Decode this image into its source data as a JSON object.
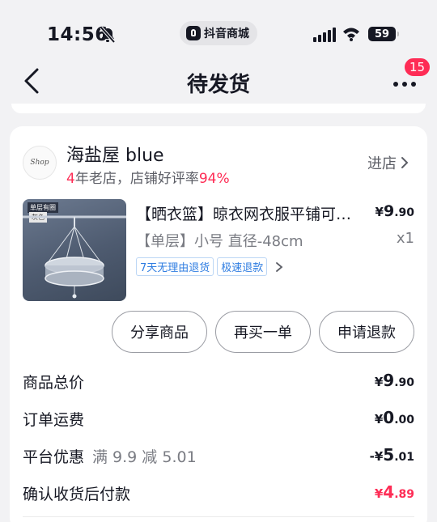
{
  "status_bar": {
    "time": "14:56",
    "app_name": "抖音商城",
    "battery": "59"
  },
  "nav": {
    "title": "待发货",
    "badge": "15"
  },
  "shop": {
    "avatar_text": "Shop",
    "name": "海盐屋 blue",
    "years": "4",
    "years_suffix": "年老店，店铺好评率",
    "rating": "94%",
    "enter_label": "进店"
  },
  "product": {
    "thumb_tag": "单层有圈",
    "thumb_tag2": "灰色",
    "title": "【晒衣篮】晾衣网衣服平铺可晾晒毛衣",
    "price_yen": "¥",
    "price_int": "9",
    "price_dec": ".90",
    "spec": "【单层】小号 直径-48cm",
    "qty": "x1",
    "tags": [
      "7天无理由退货",
      "极速退款"
    ]
  },
  "actions": {
    "share": "分享商品",
    "rebuy": "再买一单",
    "refund": "申请退款"
  },
  "summary": {
    "total_label": "商品总价",
    "total_yen": "¥",
    "total_int": "9",
    "total_dec": ".90",
    "shipping_label": "订单运费",
    "shipping_yen": "¥",
    "shipping_int": "0",
    "shipping_dec": ".00",
    "discount_label": "平台优惠",
    "discount_sub": "满 9.9 减 5.01",
    "discount_yen": "-¥",
    "discount_int": "5",
    "discount_dec": ".01",
    "pay_label": "确认收货后付款",
    "pay_yen": "¥",
    "pay_int": "4",
    "pay_dec": ".89"
  },
  "colors": {
    "accent": "#fe2c55",
    "tag_blue": "#2f7de1"
  },
  "icons": {
    "back": "chevron-left-icon",
    "more": "more-dots-icon",
    "bell": "bell-off-icon",
    "enter": "chevron-right-icon"
  }
}
